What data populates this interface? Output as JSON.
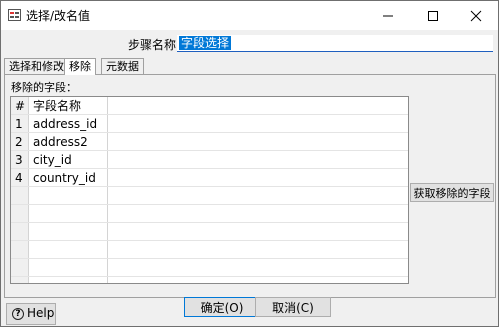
{
  "window": {
    "title": "选择/改名值",
    "icon": "select-values-icon"
  },
  "step": {
    "label": "步骤名称",
    "value": "字段选择"
  },
  "tabs": [
    {
      "label": "选择和修改",
      "active": false
    },
    {
      "label": "移除",
      "active": true
    },
    {
      "label": "元数据",
      "active": false
    }
  ],
  "remove_panel": {
    "fields_label": "移除的字段：",
    "columns": [
      "#",
      "字段名称"
    ],
    "rows": [
      {
        "num": "1",
        "name": "address_id"
      },
      {
        "num": "2",
        "name": "address2"
      },
      {
        "num": "3",
        "name": "city_id"
      },
      {
        "num": "4",
        "name": "country_id"
      }
    ],
    "get_fields_button": "获取移除的字段"
  },
  "buttons": {
    "ok": "确定(O)",
    "cancel": "取消(C)",
    "help": "Help"
  }
}
